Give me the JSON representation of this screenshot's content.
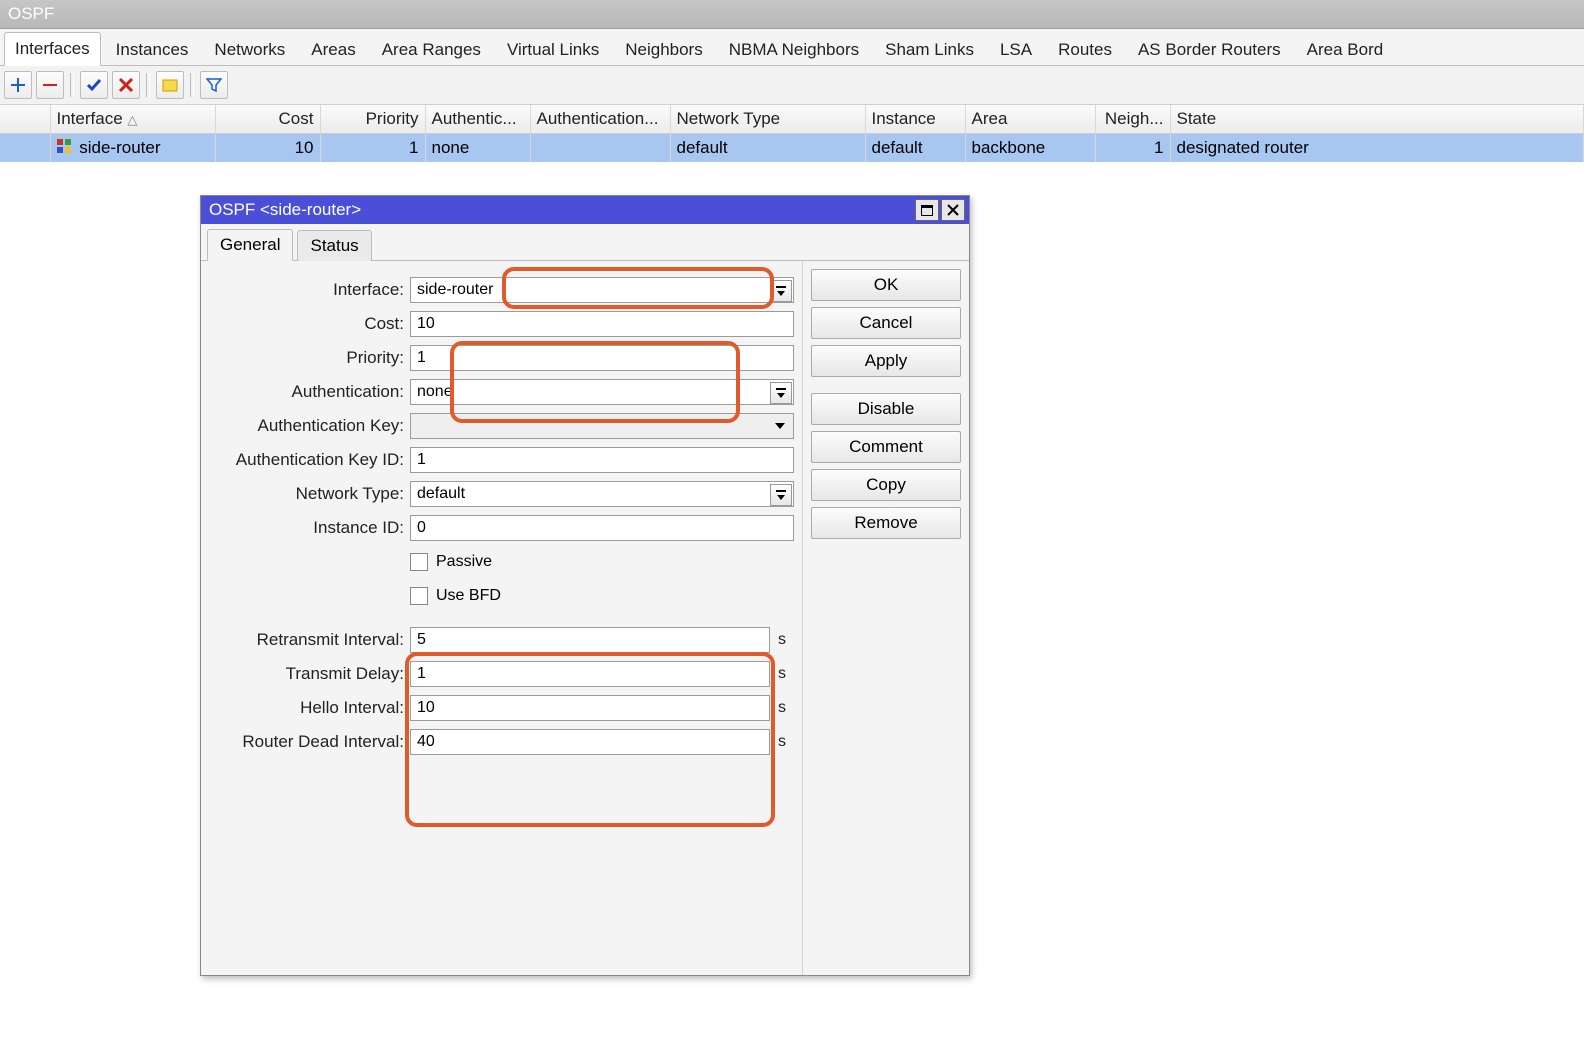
{
  "main": {
    "title": "OSPF",
    "tabs": [
      "Interfaces",
      "Instances",
      "Networks",
      "Areas",
      "Area Ranges",
      "Virtual Links",
      "Neighbors",
      "NBMA Neighbors",
      "Sham Links",
      "LSA",
      "Routes",
      "AS Border Routers",
      "Area Bord"
    ],
    "active_tab": 0,
    "columns": {
      "handle": "",
      "interface": "Interface",
      "cost": "Cost",
      "priority": "Priority",
      "auth": "Authentic...",
      "authkey": "Authentication...",
      "nettype": "Network Type",
      "instance": "Instance",
      "area": "Area",
      "neigh": "Neigh...",
      "state": "State"
    },
    "row": {
      "interface": "side-router",
      "cost": "10",
      "priority": "1",
      "auth": "none",
      "authkey": "",
      "nettype": "default",
      "instance": "default",
      "area": "backbone",
      "neigh": "1",
      "state": "designated router"
    }
  },
  "dialog": {
    "title": "OSPF <side-router>",
    "tabs": [
      "General",
      "Status"
    ],
    "active_tab": 0,
    "labels": {
      "interface": "Interface:",
      "cost": "Cost:",
      "priority": "Priority:",
      "auth": "Authentication:",
      "authkey": "Authentication Key:",
      "authkeyid": "Authentication Key ID:",
      "nettype": "Network Type:",
      "instanceid": "Instance ID:",
      "passive": "Passive",
      "usebfd": "Use BFD",
      "retransmit": "Retransmit Interval:",
      "txdelay": "Transmit Delay:",
      "hello": "Hello Interval:",
      "dead": "Router Dead Interval:"
    },
    "values": {
      "interface": "side-router",
      "cost": "10",
      "priority": "1",
      "auth": "none",
      "authkey": "",
      "authkeyid": "1",
      "nettype": "default",
      "instanceid": "0",
      "retransmit": "5",
      "txdelay": "1",
      "hello": "10",
      "dead": "40"
    },
    "unit_seconds": "s",
    "buttons": {
      "ok": "OK",
      "cancel": "Cancel",
      "apply": "Apply",
      "disable": "Disable",
      "comment": "Comment",
      "copy": "Copy",
      "remove": "Remove"
    }
  }
}
